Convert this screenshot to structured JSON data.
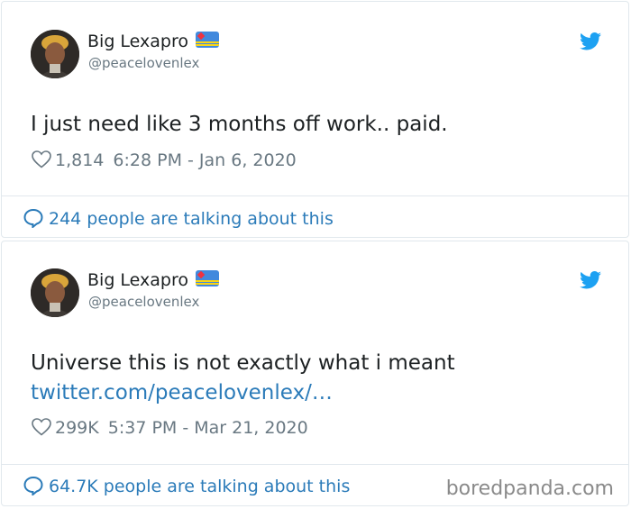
{
  "tweets": [
    {
      "author_name": "Big Lexapro",
      "handle": "@peacelovenlex",
      "text": "I just need like 3 months off work.. paid.",
      "link": "",
      "likes": "1,814",
      "timestamp": "6:28 PM - Jan 6, 2020",
      "talking": "244 people are talking about this"
    },
    {
      "author_name": "Big Lexapro",
      "handle": "@peacelovenlex",
      "text": "Universe this is not exactly what i meant",
      "link": "twitter.com/peacelovenlex/…",
      "likes": "299K",
      "timestamp": "5:37 PM - Mar 21, 2020",
      "talking": "64.7K people are talking about this"
    }
  ],
  "watermark": "boredpanda.com",
  "colors": {
    "twitter_blue": "#1da1f2",
    "link_blue": "#2b7bb9",
    "muted_gray": "#697882",
    "border": "#e1e8ed"
  },
  "icons": {
    "bird": "twitter-bird-icon",
    "heart": "heart-outline-icon",
    "bubble": "speech-bubble-icon",
    "flag": "aruba-flag-emoji"
  }
}
